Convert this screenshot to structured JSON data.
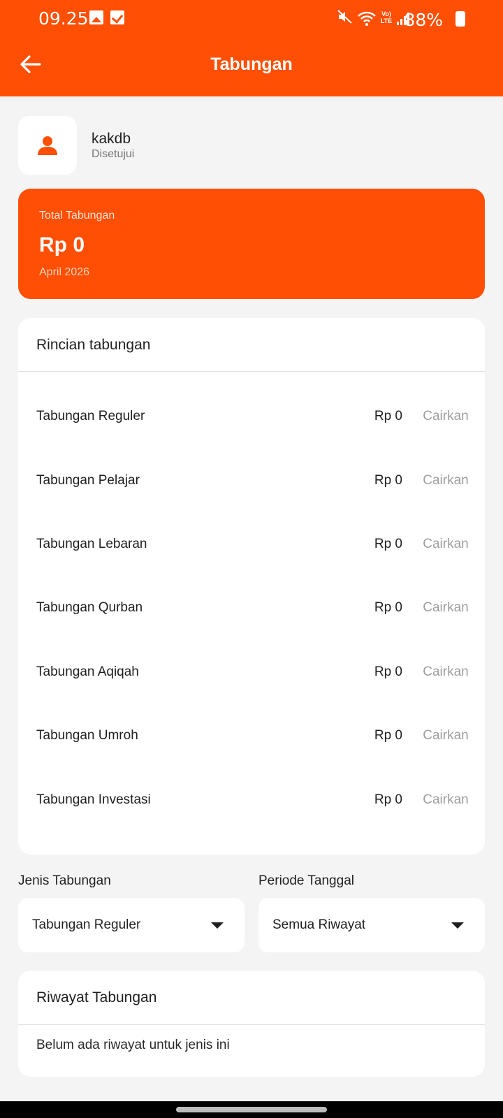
{
  "status_bar": {
    "time": "09.25",
    "lte_label": "Vo) LTE",
    "battery": "88%"
  },
  "header": {
    "title": "Tabungan"
  },
  "profile": {
    "name": "kakdb",
    "status": "Disetujui"
  },
  "total": {
    "label": "Total Tabungan",
    "amount": "Rp 0",
    "period": "April 2026"
  },
  "details": {
    "title": "Rincian tabungan",
    "items": [
      {
        "name": "Tabungan Reguler",
        "amount": "Rp 0",
        "action": "Cairkan"
      },
      {
        "name": "Tabungan Pelajar",
        "amount": "Rp 0",
        "action": "Cairkan"
      },
      {
        "name": "Tabungan Lebaran",
        "amount": "Rp 0",
        "action": "Cairkan"
      },
      {
        "name": "Tabungan Qurban",
        "amount": "Rp 0",
        "action": "Cairkan"
      },
      {
        "name": "Tabungan Aqiqah",
        "amount": "Rp 0",
        "action": "Cairkan"
      },
      {
        "name": "Tabungan Umroh",
        "amount": "Rp 0",
        "action": "Cairkan"
      },
      {
        "name": "Tabungan Investasi",
        "amount": "Rp 0",
        "action": "Cairkan"
      }
    ]
  },
  "filters": {
    "type_label": "Jenis Tabungan",
    "type_value": "Tabungan Reguler",
    "period_label": "Periode Tanggal",
    "period_value": "Semua Riwayat"
  },
  "history": {
    "title": "Riwayat Tabungan",
    "empty_message": "Belum ada riwayat untuk jenis ini"
  },
  "colors": {
    "accent": "#ff4f05",
    "background": "#f4f4f5",
    "muted_action": "#9e9e9e"
  }
}
